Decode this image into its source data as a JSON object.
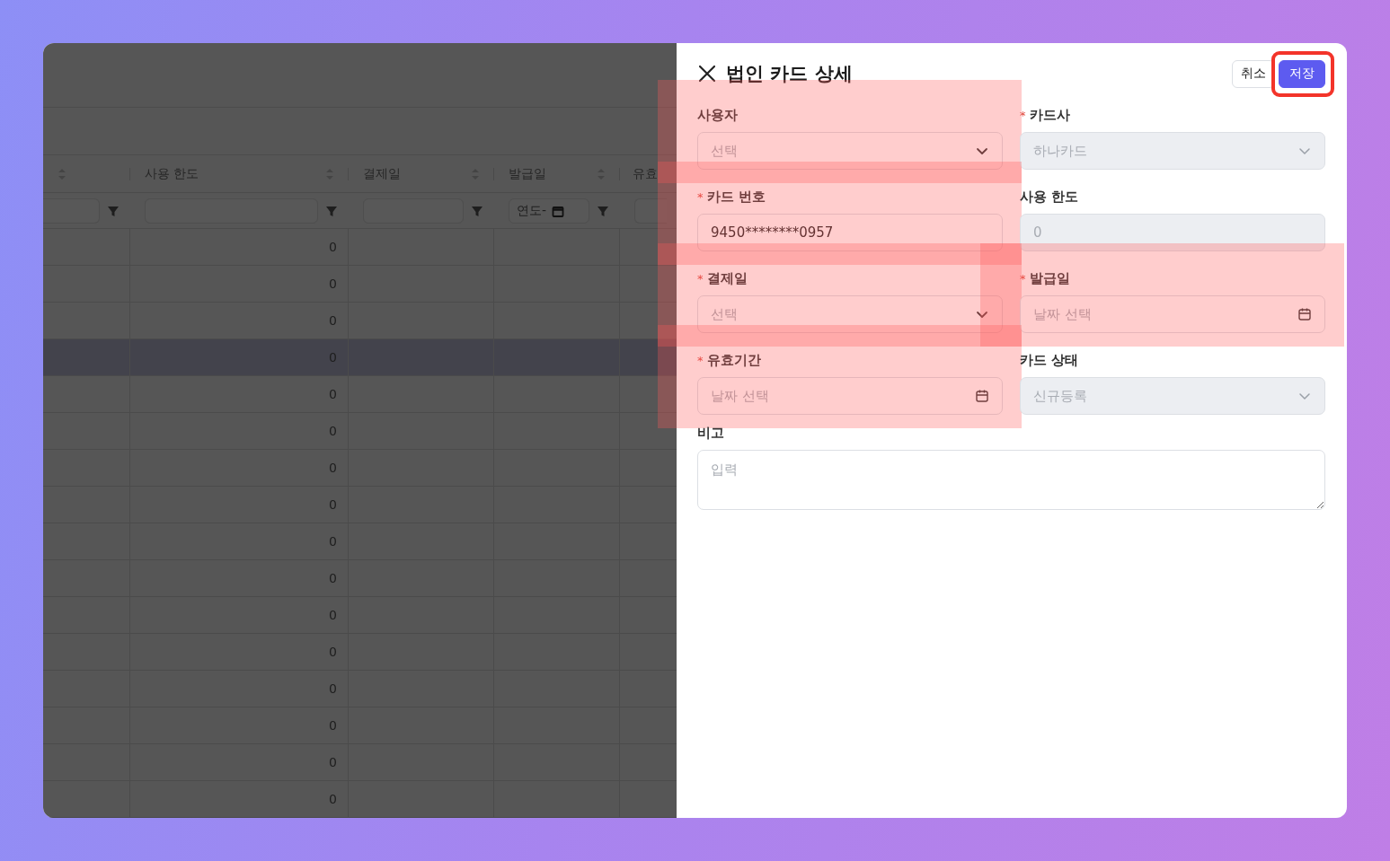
{
  "table": {
    "columns": [
      {
        "sortable": true,
        "filter": {
          "kind": "text"
        }
      },
      {
        "label": "사용 한도",
        "sortable": true,
        "filter": {
          "kind": "text"
        }
      },
      {
        "label": "결제일",
        "sortable": true,
        "filter": {
          "kind": "text"
        }
      },
      {
        "label": "발급일",
        "sortable": true,
        "filter": {
          "kind": "date",
          "value": "연도-"
        }
      },
      {
        "label": "유효",
        "sortable": false,
        "filter": {
          "kind": "text"
        }
      }
    ],
    "rows": [
      {
        "limit": "0",
        "selected": false
      },
      {
        "limit": "0",
        "selected": false
      },
      {
        "limit": "0",
        "selected": false
      },
      {
        "limit": "0",
        "selected": true
      },
      {
        "limit": "0",
        "selected": false
      },
      {
        "limit": "0",
        "selected": false
      },
      {
        "limit": "0",
        "selected": false
      },
      {
        "limit": "0",
        "selected": false
      },
      {
        "limit": "0",
        "selected": false
      },
      {
        "limit": "0",
        "selected": false
      },
      {
        "limit": "0",
        "selected": false
      },
      {
        "limit": "0",
        "selected": false
      },
      {
        "limit": "0",
        "selected": false
      },
      {
        "limit": "0",
        "selected": false
      },
      {
        "limit": "0",
        "selected": false
      },
      {
        "limit": "0",
        "selected": false
      }
    ]
  },
  "drawer": {
    "title": "법인 카드 상세",
    "buttons": [
      {
        "label": "취소",
        "kind": "secondary",
        "highlighted": false
      },
      {
        "label": "저장",
        "kind": "primary",
        "highlighted": true
      }
    ],
    "fields": [
      {
        "label": "사용자",
        "kind": "select",
        "placeholder": "선택",
        "disabled": false,
        "highlighted": true
      },
      {
        "label": "카드사",
        "required_mark": "*",
        "kind": "select",
        "value": "하나카드",
        "disabled": true,
        "highlighted": false
      },
      {
        "label": "카드 번호",
        "required_mark": "*",
        "kind": "input",
        "value": "9450********0957",
        "disabled": false,
        "highlighted": true
      },
      {
        "label": "사용 한도",
        "kind": "input",
        "value": "0",
        "disabled": true,
        "highlighted": false
      },
      {
        "label": "결제일",
        "required_mark": "*",
        "kind": "select",
        "placeholder": "선택",
        "disabled": false,
        "highlighted": true
      },
      {
        "label": "발급일",
        "required_mark": "*",
        "kind": "date",
        "placeholder": "날짜 선택",
        "disabled": false,
        "highlighted": true
      },
      {
        "label": "유효기간",
        "required_mark": "*",
        "kind": "date",
        "placeholder": "날짜 선택",
        "disabled": false,
        "highlighted": true
      },
      {
        "label": "카드 상태",
        "kind": "select",
        "value": "신규등록",
        "disabled": true,
        "highlighted": false
      },
      {
        "label": "비고",
        "kind": "textarea",
        "placeholder": "입력",
        "highlighted": false
      }
    ]
  }
}
